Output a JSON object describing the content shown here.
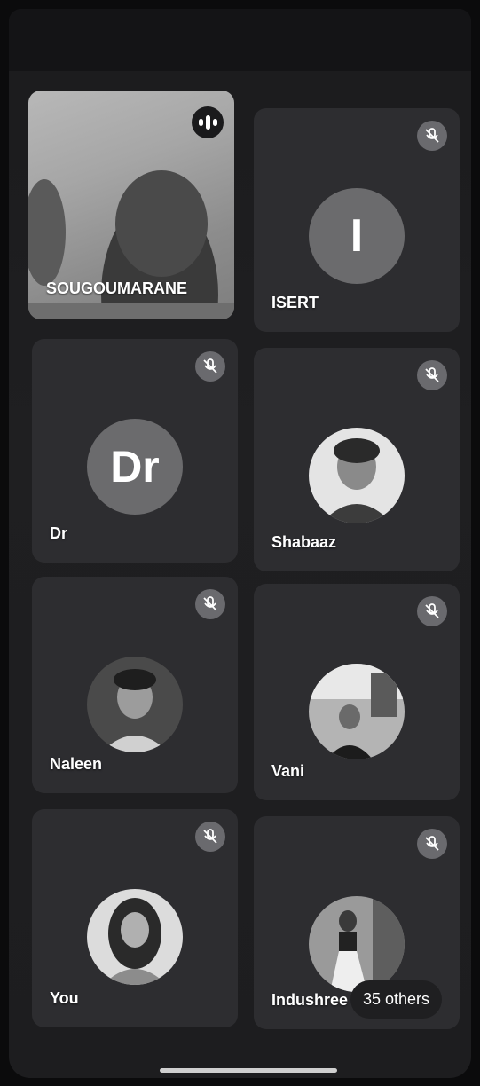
{
  "participants": [
    {
      "name": "SOUGOUMARANE",
      "kind": "video",
      "state": "speaking"
    },
    {
      "name": "ISERT",
      "kind": "initial",
      "initial": "I",
      "state": "muted"
    },
    {
      "name": "Dr",
      "kind": "initial",
      "initial": "Dr",
      "state": "muted"
    },
    {
      "name": "Shabaaz",
      "kind": "photo",
      "state": "muted"
    },
    {
      "name": "Naleen",
      "kind": "photo",
      "state": "muted"
    },
    {
      "name": "Vani",
      "kind": "photo",
      "state": "muted"
    },
    {
      "name": "You",
      "kind": "photo",
      "state": "muted"
    },
    {
      "name": "Indushree",
      "kind": "photo",
      "state": "muted"
    }
  ],
  "others_label": "35 others",
  "icons": {
    "speaking": "audio-bars-icon",
    "muted": "mic-off-icon"
  },
  "colors": {
    "tile": "#2d2d30",
    "avatar_initial_bg": "#6b6b6d",
    "mute_badge": "#6a6a6e"
  }
}
